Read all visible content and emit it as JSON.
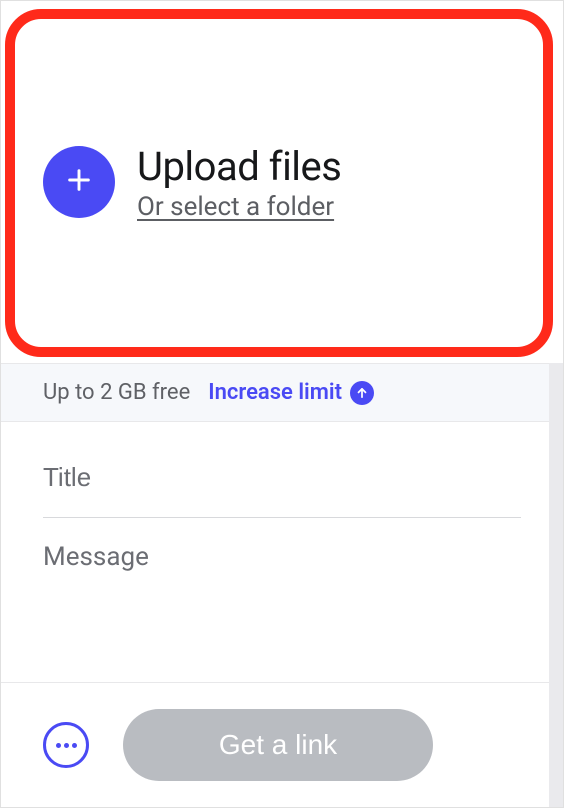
{
  "upload": {
    "title": "Upload files",
    "folder_link": "Or select a folder",
    "plus_icon": "plus-icon"
  },
  "limit": {
    "free_text": "Up to 2 GB free",
    "increase_label": "Increase limit",
    "arrow_icon": "arrow-up-icon"
  },
  "fields": {
    "title_placeholder": "Title",
    "message_placeholder": "Message"
  },
  "actions": {
    "more_icon": "more-dots-icon",
    "link_button": "Get a link"
  },
  "colors": {
    "accent": "#4a4af4",
    "highlight": "#ff2a1a",
    "disabled": "#b9bcc1"
  }
}
